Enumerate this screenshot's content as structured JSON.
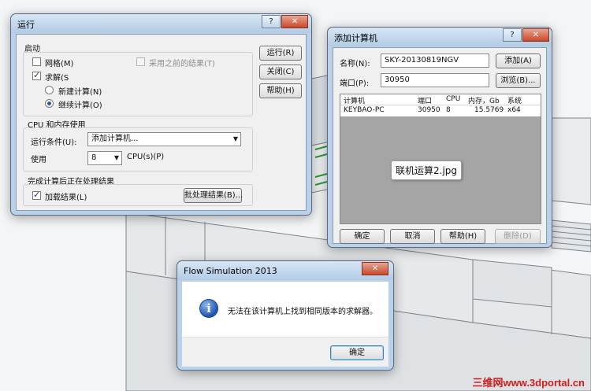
{
  "run_dialog": {
    "title": "运行",
    "help_btn": "?",
    "close_btn": "✕",
    "group_start": "启动",
    "mesh_label": "网格(M)",
    "use_previous_label": "采用之前的结果(T)",
    "solve_label": "求解(S",
    "new_calc_label": "新建计算(N)",
    "continue_calc_label": "继续计算(O)",
    "run_button": "运行(R)",
    "close_button": "关闭(C)",
    "help_button": "帮助(H)",
    "group_cpu": "CPU 和内存使用",
    "run_on_label": "运行条件(U):",
    "run_on_value": "添加计算机...",
    "use_label": "使用",
    "cpu_count": "8",
    "cpu_unit": "CPU(s)(P)",
    "group_after": "完成计算后正在处理结果",
    "load_results_label": "加载结果(L)",
    "batch_button": "批处理结果(B)..."
  },
  "add_computer_dialog": {
    "title": "添加计算机",
    "help_btn": "?",
    "close_btn": "✕",
    "name_label": "名称(N):",
    "name_value": "SKY-20130819NGV",
    "add_button": "添加(A)",
    "port_label": "端口(P):",
    "port_value": "30950",
    "browse_button": "浏览(B)...",
    "columns": [
      "计算机",
      "端口",
      "CPU",
      "内存，Gb",
      "系统"
    ],
    "rows": [
      {
        "computer": "KEYBAO-PC",
        "port": "30950",
        "cpu": "8",
        "memory": "15.5769",
        "system": "x64"
      }
    ],
    "image_tag": "联机运算2.jpg",
    "ok_button": "确定",
    "cancel_button": "取消",
    "help_button": "帮助(H)",
    "delete_button": "删除(D)"
  },
  "message_box": {
    "title": "Flow Simulation 2013",
    "close_btn": "✕",
    "message": "无法在该计算机上找到相同版本的求解器。",
    "ok_button": "确定"
  },
  "watermark": {
    "brand": "三维网",
    "url": "www.3dportal.cn"
  }
}
